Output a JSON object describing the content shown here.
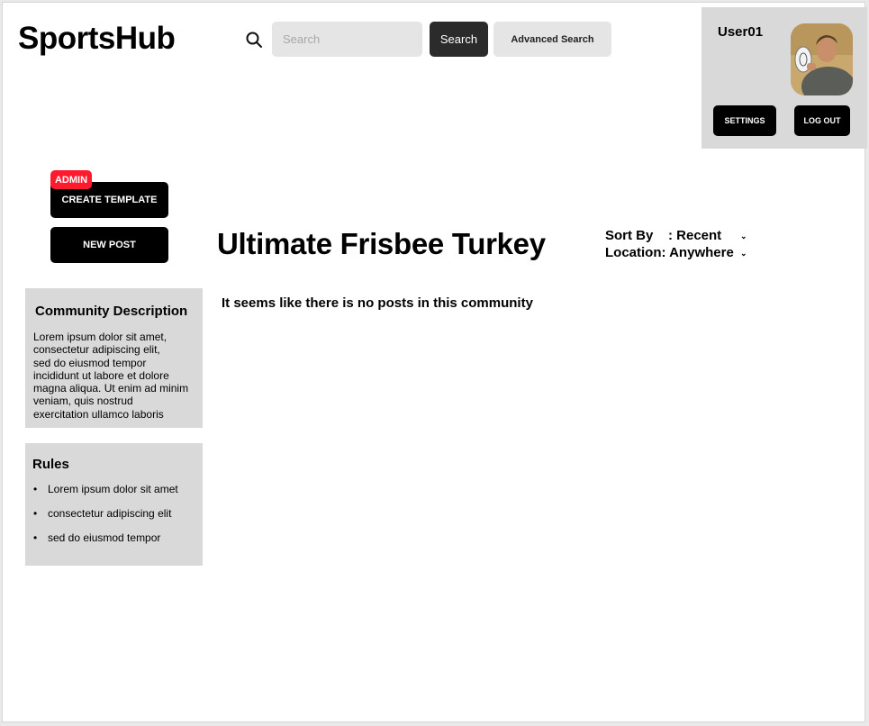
{
  "header": {
    "logo": "SportsHub",
    "search_placeholder": "Search",
    "search_button": "Search",
    "advanced_search_button": "Advanced Search"
  },
  "user": {
    "name": "User01",
    "settings_button": "SETTINGS",
    "logout_button": "LOG OUT"
  },
  "actions": {
    "admin_badge": "ADMIN",
    "create_template": "CREATE TEMPLATE",
    "new_post": "NEW POST"
  },
  "community": {
    "title": "Ultimate Frisbee Turkey",
    "sort_label": "Sort By",
    "sort_value": ": Recent",
    "location_label": "Location: Anywhere",
    "empty_message": "It seems like there is no posts in this community"
  },
  "description": {
    "title": "Community Description",
    "lines": [
      "Lorem ipsum dolor sit amet,",
      "consectetur adipiscing elit,",
      "sed do eiusmod tempor",
      "incididunt ut labore et dolore",
      "magna aliqua. Ut enim ad minim",
      "veniam, quis nostrud",
      "exercitation ullamco laboris"
    ]
  },
  "rules": {
    "title": "Rules",
    "items": [
      "Lorem ipsum dolor sit amet",
      "consectetur adipiscing elit",
      "sed do eiusmod tempor"
    ]
  },
  "icons": {
    "search": "search-icon",
    "chevron": "chevron-down-icon"
  },
  "colors": {
    "primary_button": "#000000",
    "admin_badge": "#ff1a2e",
    "panel_bg": "#d9d9d9"
  }
}
